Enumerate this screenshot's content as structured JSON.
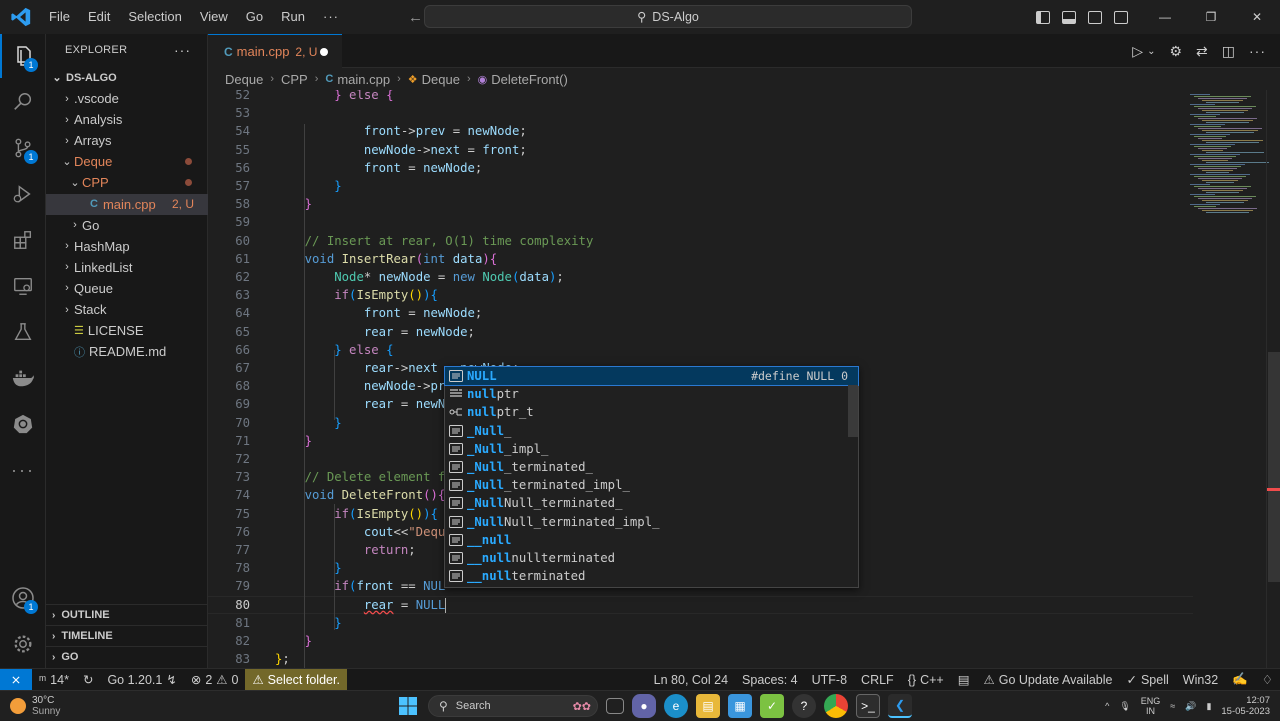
{
  "titlebar": {
    "menu": [
      "File",
      "Edit",
      "Selection",
      "View",
      "Go",
      "Run",
      "···"
    ],
    "search_text": "DS-Algo"
  },
  "activity": {
    "explorer_badge": "1",
    "scm_badge": "1",
    "accounts_badge": "1"
  },
  "sidebar": {
    "title": "EXPLORER",
    "root": "DS-ALGO",
    "items": [
      {
        "label": ".vscode",
        "indent": 1,
        "chev": "›",
        "state": ""
      },
      {
        "label": "Analysis",
        "indent": 1,
        "chev": "›",
        "state": ""
      },
      {
        "label": "Arrays",
        "indent": 1,
        "chev": "›",
        "state": ""
      },
      {
        "label": "Deque",
        "indent": 1,
        "chev": "⌄",
        "state": "mod"
      },
      {
        "label": "CPP",
        "indent": 2,
        "chev": "⌄",
        "state": "mod"
      },
      {
        "label": "main.cpp",
        "indent": 3,
        "chev": "",
        "state": "sel",
        "suffix": "2, U"
      },
      {
        "label": "Go",
        "indent": 2,
        "chev": "›",
        "state": ""
      },
      {
        "label": "HashMap",
        "indent": 1,
        "chev": "›",
        "state": ""
      },
      {
        "label": "LinkedList",
        "indent": 1,
        "chev": "›",
        "state": ""
      },
      {
        "label": "Queue",
        "indent": 1,
        "chev": "›",
        "state": ""
      },
      {
        "label": "Stack",
        "indent": 1,
        "chev": "›",
        "state": ""
      },
      {
        "label": "LICENSE",
        "indent": 1,
        "chev": "",
        "state": ""
      },
      {
        "label": "README.md",
        "indent": 1,
        "chev": "",
        "state": ""
      }
    ],
    "sections": [
      "OUTLINE",
      "TIMELINE",
      "GO"
    ]
  },
  "tab": {
    "name": "main.cpp",
    "status": "2, U"
  },
  "breadcrumbs": [
    "Deque",
    "CPP",
    "main.cpp",
    "Deque",
    "DeleteFront()"
  ],
  "editor": {
    "current_line": 80,
    "lines": [
      {
        "n": "52",
        "html": "        <span class='pu2'>}</span> <span class='ct'>else</span> <span class='pu2'>{</span>"
      },
      {
        "n": "53",
        "html": ""
      },
      {
        "n": "54",
        "html": "            <span class='va'>front</span>-&gt;<span class='va'>prev</span> = <span class='va'>newNode</span>;"
      },
      {
        "n": "55",
        "html": "            <span class='va'>newNode</span>-&gt;<span class='va'>next</span> = <span class='va'>front</span>;"
      },
      {
        "n": "56",
        "html": "            <span class='va'>front</span> = <span class='va'>newNode</span>;"
      },
      {
        "n": "57",
        "html": "        <span class='pu3'>}</span>"
      },
      {
        "n": "58",
        "html": "    <span class='pu2'>}</span>"
      },
      {
        "n": "59",
        "html": ""
      },
      {
        "n": "60",
        "html": "    <span class='cm'>// Insert at rear, O(1) time complexity</span>"
      },
      {
        "n": "61",
        "html": "    <span class='kw'>void</span> <span class='fn'>InsertRear</span><span class='pu2'>(</span><span class='kw'>int</span> <span class='va'>data</span><span class='pu2'>){</span>"
      },
      {
        "n": "62",
        "html": "        <span class='ty'>Node</span>* <span class='va'>newNode</span> = <span class='kw'>new</span> <span class='ty'>Node</span><span class='pu3'>(</span><span class='va'>data</span><span class='pu3'>)</span>;"
      },
      {
        "n": "63",
        "html": "        <span class='ct'>if</span><span class='pu3'>(</span><span class='fn'>IsEmpty</span><span class='pu'>()</span><span class='pu3'>){</span>"
      },
      {
        "n": "64",
        "html": "            <span class='va'>front</span> = <span class='va'>newNode</span>;"
      },
      {
        "n": "65",
        "html": "            <span class='va'>rear</span> = <span class='va'>newNode</span>;"
      },
      {
        "n": "66",
        "html": "        <span class='pu3'>}</span> <span class='ct'>else</span> <span class='pu3'>{</span>"
      },
      {
        "n": "67",
        "html": "            <span class='va'>rear</span>-&gt;<span class='va'>next</span> = <span class='va'>newNode</span>;"
      },
      {
        "n": "68",
        "html": "            <span class='va'>newNode</span>-&gt;<span class='va'>pr</span>"
      },
      {
        "n": "69",
        "html": "            <span class='va'>rear</span> = <span class='va'>newN</span>"
      },
      {
        "n": "70",
        "html": "        <span class='pu3'>}</span>"
      },
      {
        "n": "71",
        "html": "    <span class='pu2'>}</span>"
      },
      {
        "n": "72",
        "html": ""
      },
      {
        "n": "73",
        "html": "    <span class='cm'>// Delete element f</span>"
      },
      {
        "n": "74",
        "html": "    <span class='kw'>void</span> <span class='fn'>DeleteFront</span><span class='pu2'>(){</span>"
      },
      {
        "n": "75",
        "html": "        <span class='ct'>if</span><span class='pu3'>(</span><span class='fn'>IsEmpty</span><span class='pu'>()</span><span class='pu3'>){</span>"
      },
      {
        "n": "76",
        "html": "            <span class='va'>cout</span>&lt;&lt;<span class='st'>\"Dequ</span>"
      },
      {
        "n": "77",
        "html": "            <span class='ct'>return</span>;"
      },
      {
        "n": "78",
        "html": "        <span class='pu3'>}</span>"
      },
      {
        "n": "79",
        "html": "        <span class='ct'>if</span><span class='pu3'>(</span><span class='va'>front</span> == <span class='kw'>NUL</span>"
      },
      {
        "n": "80",
        "html": "            <span class='va squig'>rear</span> = <span class='kw'>NULL</span>"
      },
      {
        "n": "81",
        "html": "        <span class='pu3'>}</span>"
      },
      {
        "n": "82",
        "html": "    <span class='pu2'>}</span>"
      },
      {
        "n": "83",
        "html": "<span class='pu'>}</span>;"
      }
    ]
  },
  "suggest": {
    "items": [
      {
        "hl": "NULL",
        "rest": "",
        "icon": "text",
        "detail": "#define NULL 0"
      },
      {
        "hl": "null",
        "rest": "ptr",
        "icon": "keyword"
      },
      {
        "hl": "null",
        "rest": "ptr_t",
        "icon": "type"
      },
      {
        "hl": "_Null",
        "rest": "_",
        "icon": "text"
      },
      {
        "hl": "_Null",
        "rest": "_impl_",
        "icon": "text"
      },
      {
        "hl": "_Null",
        "rest": "_terminated_",
        "icon": "text"
      },
      {
        "hl": "_Null",
        "rest": "_terminated_impl_",
        "icon": "text"
      },
      {
        "hl": "_Null",
        "rest": "Null_terminated_",
        "icon": "text"
      },
      {
        "hl": "_Null",
        "rest": "Null_terminated_impl_",
        "icon": "text"
      },
      {
        "hl": "__null",
        "rest": "",
        "icon": "text"
      },
      {
        "hl": "__null",
        "rest": "nullterminated",
        "icon": "text"
      },
      {
        "hl": "__null",
        "rest": "terminated",
        "icon": "text"
      }
    ]
  },
  "status": {
    "remote": "⨯",
    "ports": "14*",
    "go_version": "Go 1.20.1",
    "errors": "2",
    "warnings": "0",
    "select_folder": "Select folder.",
    "position": "Ln 80, Col 24",
    "spaces": "Spaces: 4",
    "encoding": "UTF-8",
    "eol": "CRLF",
    "language": "C++",
    "go_update": "Go Update Available",
    "spell": "Spell",
    "platform": "Win32"
  },
  "taskbar": {
    "temp": "30°C",
    "weather": "Sunny",
    "search_placeholder": "Search",
    "lang": "ENG",
    "region": "IN",
    "time": "12:07",
    "date": "15-05-2023"
  },
  "colors": {
    "accent": "#0078d4",
    "modified": "#e2855a",
    "warning_bg": "#73682a"
  }
}
